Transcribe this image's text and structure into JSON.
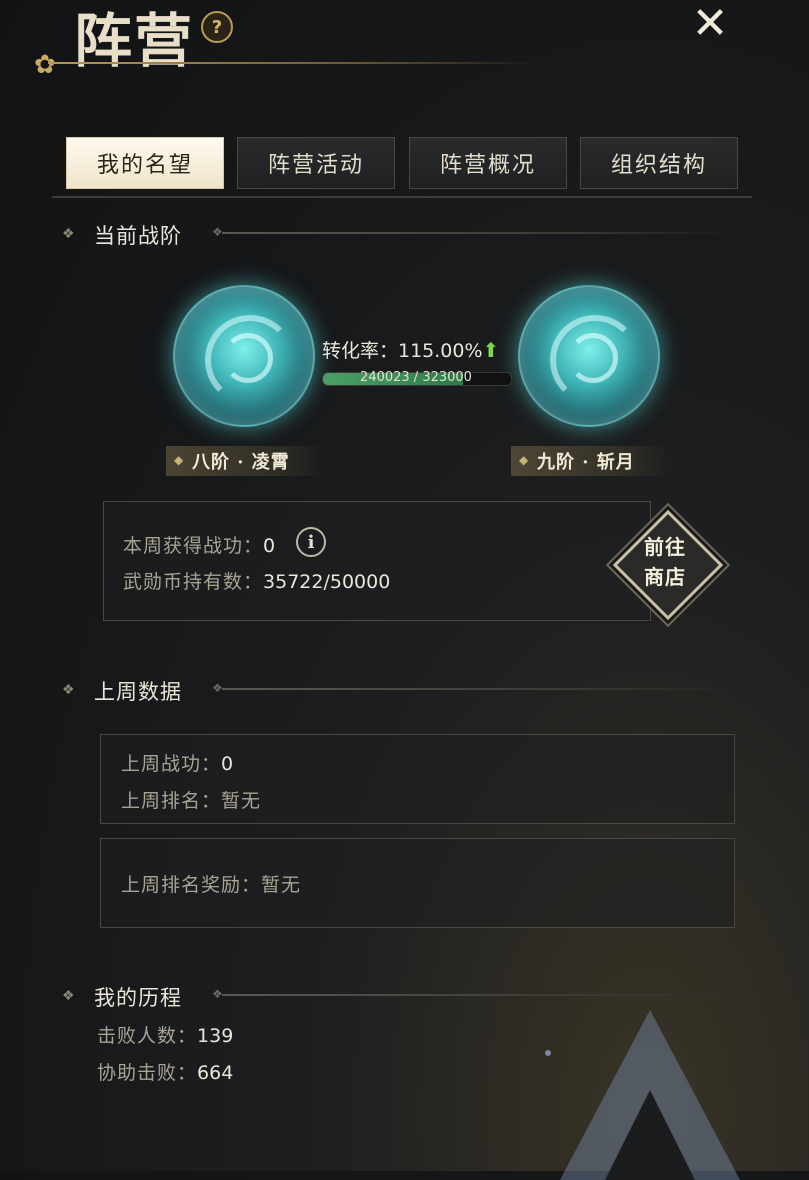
{
  "header": {
    "title": "阵营",
    "help_icon": "?",
    "close_icon": "✕"
  },
  "tabs": [
    {
      "label": "我的名望",
      "active": true
    },
    {
      "label": "阵营活动",
      "active": false
    },
    {
      "label": "阵营概况",
      "active": false
    },
    {
      "label": "组织结构",
      "active": false
    }
  ],
  "current_rank": {
    "heading": "当前战阶",
    "from_rank": "八阶 · 凌霄",
    "to_rank": "九阶 · 斩月",
    "rate_label": "转化率：115.00%",
    "progress_text": "240023 / 323000",
    "progress_value": 240023,
    "progress_max": 323000,
    "weekly_merit_label": "本周获得战功：",
    "weekly_merit_value": "0",
    "coins_label": "武勋币持有数：",
    "coins_value": "35722/50000",
    "shop_line1": "前往",
    "shop_line2": "商店"
  },
  "last_week": {
    "heading": "上周数据",
    "merit_label": "上周战功：",
    "merit_value": "0",
    "rank_label": "上周排名：",
    "rank_value": "暂无",
    "reward_label": "上周排名奖励：",
    "reward_value": "暂无"
  },
  "history": {
    "heading": "我的历程",
    "defeats_label": "击败人数：",
    "defeats_value": "139",
    "assists_label": "协助击败：",
    "assists_value": "664"
  },
  "colors": {
    "accent_gold": "#b89a55",
    "orb_cyan": "#3fb3b6",
    "progress_green": "#4aa066",
    "arrow_green": "#7bd64a"
  }
}
